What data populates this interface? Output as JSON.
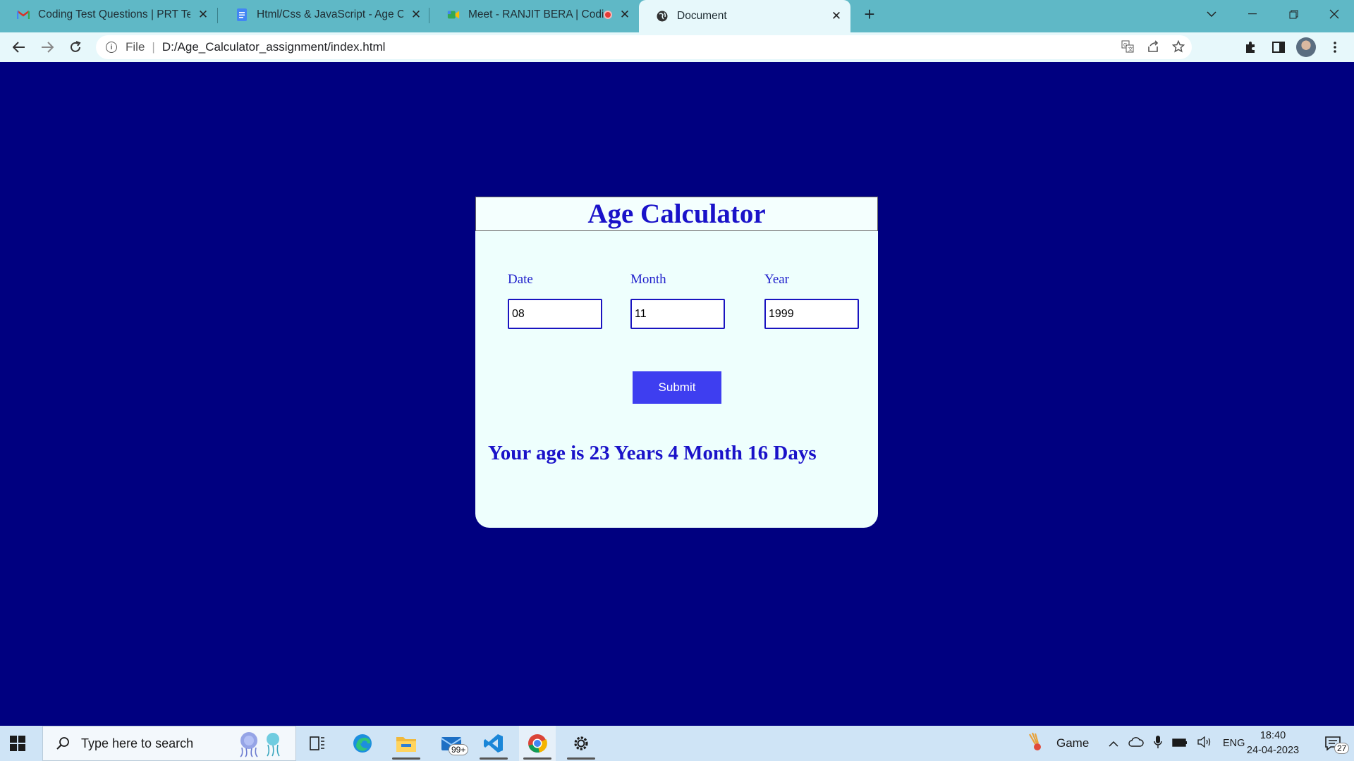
{
  "browser": {
    "tabs": [
      {
        "title": "Coding Test Questions | PRT Test",
        "icon": "gmail-icon"
      },
      {
        "title": "Html/Css & JavaScript - Age Calc",
        "icon": "docs-icon"
      },
      {
        "title": "Meet - RANJIT BERA | Coding",
        "icon": "meet-icon"
      },
      {
        "title": "Document",
        "icon": "globe-icon"
      }
    ],
    "address": {
      "scheme": "File",
      "url": "D:/Age_Calculator_assignment/index.html"
    }
  },
  "app": {
    "title": "Age Calculator",
    "fields": {
      "date": {
        "label": "Date",
        "value": "08"
      },
      "month": {
        "label": "Month",
        "value": "11"
      },
      "year": {
        "label": "Year",
        "value": "1999"
      }
    },
    "submit_label": "Submit",
    "result": "Your age is 23 Years 4 Month 16 Days"
  },
  "taskbar": {
    "search_placeholder": "Type here to search",
    "mail_badge": "99+",
    "game_label": "Game",
    "language": "ENG",
    "time": "18:40",
    "date": "24-04-2023",
    "notification_count": "27"
  },
  "colors": {
    "page_background": "#000080",
    "card_background": "#eefffd",
    "accent": "#1a12c9",
    "button": "#3e3ef0"
  }
}
